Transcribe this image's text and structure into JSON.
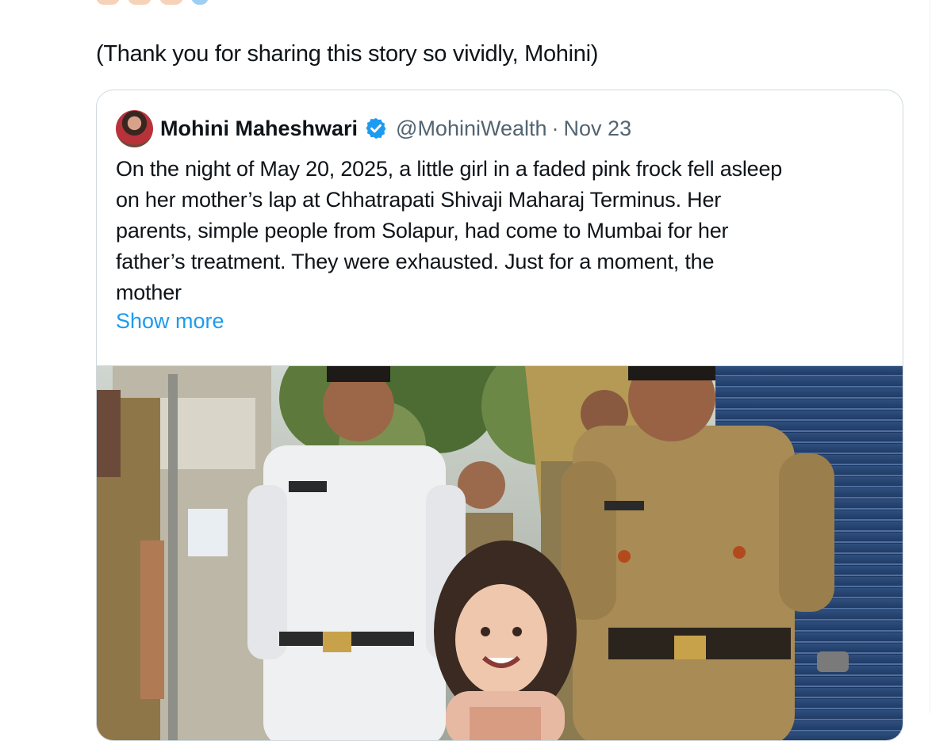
{
  "reply": {
    "emoji_row": [
      "clap-emoji",
      "clap-emoji",
      "clap-emoji",
      "pray-emoji"
    ],
    "text": "(Thank you for sharing this story so vividly,  Mohini)"
  },
  "quoted_post": {
    "author_name": "Mohini Maheshwari",
    "handle": "@MohiniWealth",
    "separator": "·",
    "date": "Nov 23",
    "body_lines": [
      "On the night of May 20, 2025, a little girl in a faded pink frock fell asleep",
      "on her mother’s lap at Chhatrapati Shivaji Maharaj Terminus. Her",
      "parents, simple people from Solapur, had come to Mumbai for her",
      "father’s treatment. They were exhausted. Just for a moment, the",
      "mother"
    ],
    "show_more_label": "Show more",
    "verified_color": "#1d9bf0",
    "media_icon": "photo-police-officers-with-girl"
  },
  "colors": {
    "text_primary": "#0f1419",
    "text_secondary": "#536471",
    "link": "#1d9bf0",
    "border": "#cfd9de"
  }
}
